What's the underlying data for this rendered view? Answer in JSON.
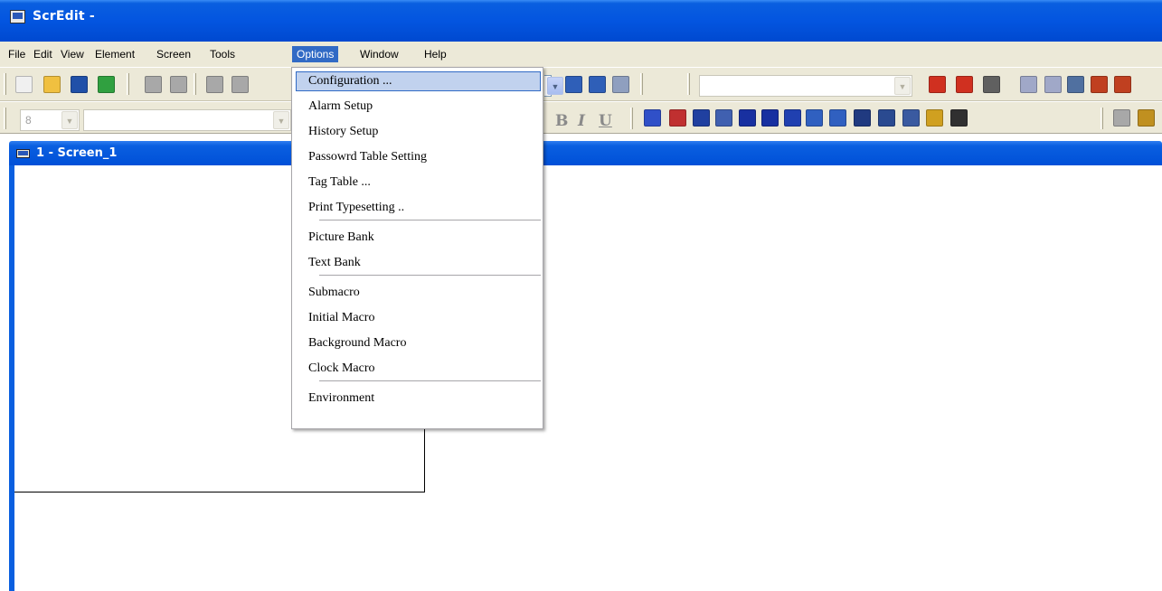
{
  "window": {
    "title": "ScrEdit -"
  },
  "menubar": {
    "items": [
      {
        "label": "File",
        "name": "menu-file"
      },
      {
        "label": "Edit",
        "name": "menu-edit"
      },
      {
        "label": "View",
        "name": "menu-view"
      },
      {
        "label": "Element",
        "name": "menu-element"
      },
      {
        "label": "Screen",
        "name": "menu-screen"
      },
      {
        "label": "Tools",
        "name": "menu-tools"
      },
      {
        "label": "Options",
        "name": "menu-options"
      },
      {
        "label": "Window",
        "name": "menu-window"
      },
      {
        "label": "Help",
        "name": "menu-help"
      }
    ],
    "active": "Options"
  },
  "toolbar": {
    "font_size_value": "8",
    "format": {
      "bold": "B",
      "italic": "I",
      "underline": "U"
    },
    "icons": [
      {
        "name": "new-file-icon",
        "color": "#f0f0f0"
      },
      {
        "name": "open-folder-icon",
        "color": "#f0c040"
      },
      {
        "name": "save-icon",
        "color": "#2050a8"
      },
      {
        "name": "export-icon",
        "color": "#30a040"
      },
      {
        "name": "undo-icon",
        "color": "#a8a8a8"
      },
      {
        "name": "redo-icon",
        "color": "#a8a8a8"
      },
      {
        "name": "cut-icon",
        "color": "#a8a8a8"
      },
      {
        "name": "copy-icon",
        "color": "#a8a8a8"
      },
      {
        "name": "zoom-in-icon",
        "color": "#2f5fb8"
      },
      {
        "name": "zoom-out-icon",
        "color": "#2f5fb8"
      },
      {
        "name": "zoom-fit-icon",
        "color": "#8f9fbf"
      },
      {
        "name": "tag-icon",
        "color": "#d03020"
      },
      {
        "name": "tag-link-icon",
        "color": "#d03020"
      },
      {
        "name": "properties-icon",
        "color": "#606060"
      },
      {
        "name": "arrow-left-icon",
        "color": "#a0a8c8"
      },
      {
        "name": "arrow-right-icon",
        "color": "#a0a8c8"
      },
      {
        "name": "calendar-icon",
        "color": "#5070a0"
      },
      {
        "name": "download-icon",
        "color": "#c04020"
      },
      {
        "name": "upload-icon",
        "color": "#c04020"
      }
    ],
    "element_icons": [
      {
        "name": "button-element-icon",
        "color": "#3050c8"
      },
      {
        "name": "chart-element-icon",
        "color": "#c03030"
      },
      {
        "name": "display-element-icon",
        "color": "#2040a0"
      },
      {
        "name": "line-element-icon",
        "color": "#4060b0"
      },
      {
        "name": "pie-element-icon",
        "color": "#1830a0"
      },
      {
        "name": "circle-element-icon",
        "color": "#1830a0"
      },
      {
        "name": "grid-element-icon",
        "color": "#2040b0"
      },
      {
        "name": "input-element-icon",
        "color": "#3060c0"
      },
      {
        "name": "panel-element-icon",
        "color": "#3060c0"
      },
      {
        "name": "picture-element-icon",
        "color": "#203a80"
      },
      {
        "name": "table-element-icon",
        "color": "#2a4a90"
      },
      {
        "name": "alarm-element-icon",
        "color": "#3a5aa0"
      },
      {
        "name": "multicolor-element-icon",
        "color": "#d0a020"
      },
      {
        "name": "keypad-element-icon",
        "color": "#303030"
      },
      {
        "name": "pencil-icon",
        "color": "#a8a8a8"
      },
      {
        "name": "paint-icon",
        "color": "#c09020"
      }
    ]
  },
  "screen": {
    "title": "1 - Screen_1"
  },
  "dropdown": {
    "groups": [
      [
        {
          "label": "Configuration ...",
          "name": "menu-item-configuration",
          "selected": true
        },
        {
          "label": "Alarm Setup",
          "name": "menu-item-alarm-setup"
        },
        {
          "label": "History Setup",
          "name": "menu-item-history-setup"
        },
        {
          "label": "Passowrd Table Setting",
          "name": "menu-item-password-table-setting"
        },
        {
          "label": "Tag Table ...",
          "name": "menu-item-tag-table"
        },
        {
          "label": "Print Typesetting ..",
          "name": "menu-item-print-typesetting"
        }
      ],
      [
        {
          "label": "Picture Bank",
          "name": "menu-item-picture-bank"
        },
        {
          "label": "Text Bank",
          "name": "menu-item-text-bank"
        }
      ],
      [
        {
          "label": "Submacro",
          "name": "menu-item-submacro"
        },
        {
          "label": "Initial Macro",
          "name": "menu-item-initial-macro"
        },
        {
          "label": "Background Macro",
          "name": "menu-item-background-macro"
        },
        {
          "label": "Clock Macro",
          "name": "menu-item-clock-macro"
        }
      ],
      [
        {
          "label": "Environment",
          "name": "menu-item-environment"
        }
      ]
    ]
  }
}
